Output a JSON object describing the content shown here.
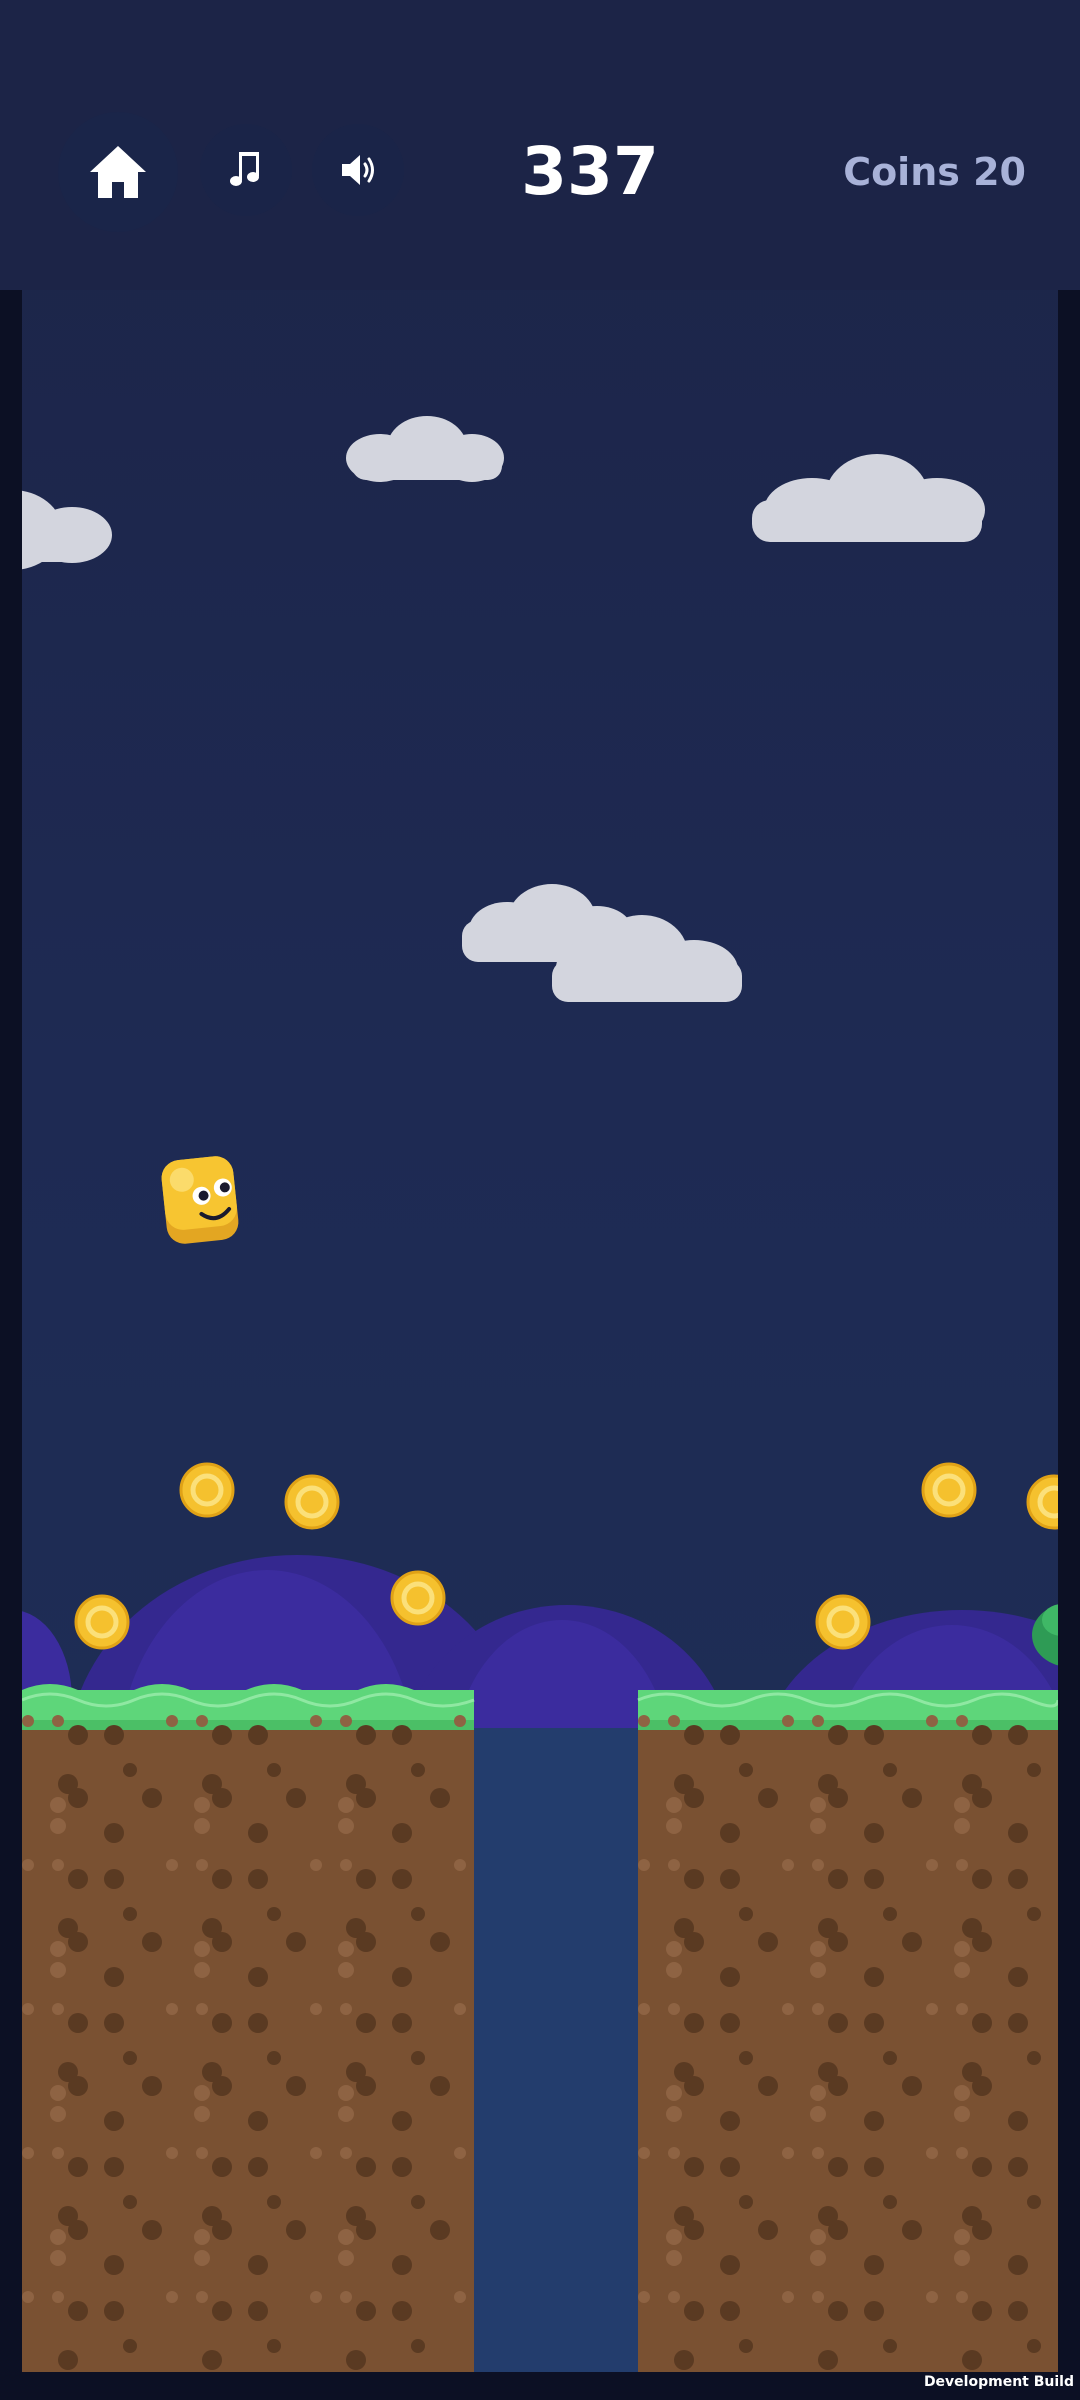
{
  "hud": {
    "score": "337",
    "coins_label": "Coins 20"
  },
  "footer": {
    "build_label": "Development Build"
  },
  "icons": {
    "home": "home-icon",
    "music": "music-note-icon",
    "sound": "speaker-icon"
  },
  "colors": {
    "sky": "#1e2a53",
    "cloud": "#d3d5de",
    "hill": "#3b2c9e",
    "grass": "#5ed67a",
    "dirt": "#7a5132",
    "coin": "#f5c12e",
    "player": "#f7c531"
  }
}
